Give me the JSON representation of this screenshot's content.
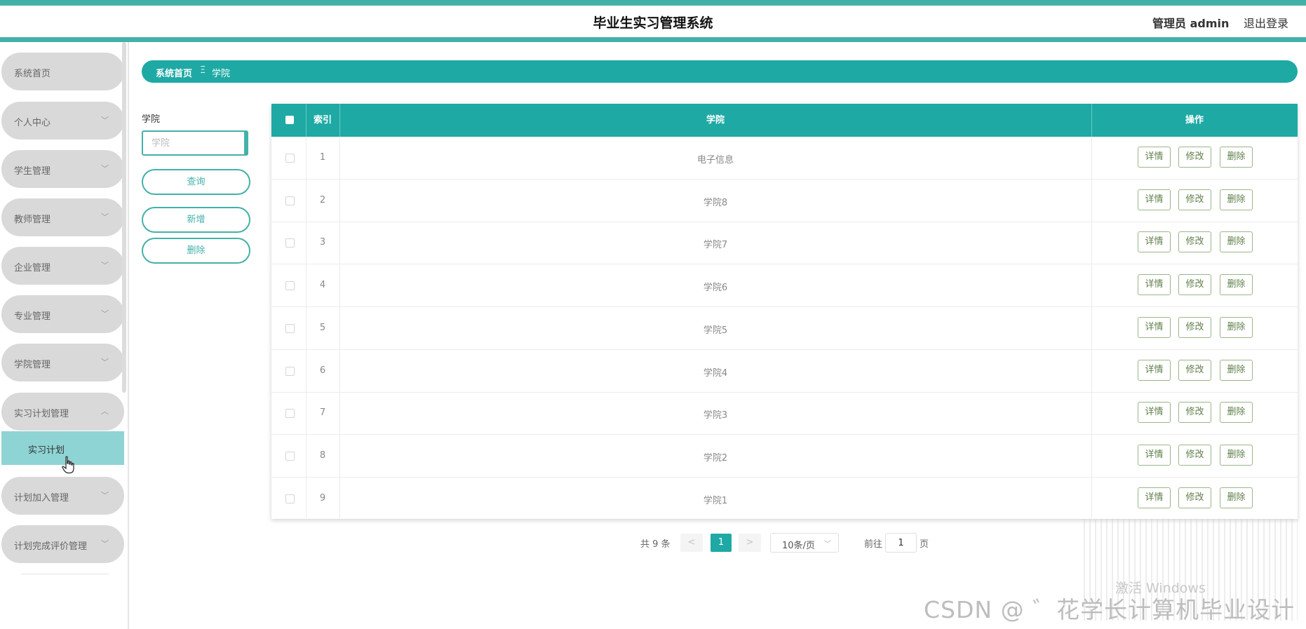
{
  "header": {
    "title": "毕业生实习管理系统",
    "admin_label": "管理员 admin",
    "logout_label": "退出登录"
  },
  "sidebar": {
    "items": [
      {
        "label": "系统首页",
        "has_chevron": false
      },
      {
        "label": "个人中心",
        "has_chevron": true
      },
      {
        "label": "学生管理",
        "has_chevron": true
      },
      {
        "label": "教师管理",
        "has_chevron": true
      },
      {
        "label": "企业管理",
        "has_chevron": true
      },
      {
        "label": "专业管理",
        "has_chevron": true
      },
      {
        "label": "学院管理",
        "has_chevron": true
      },
      {
        "label": "实习计划管理",
        "has_chevron": true,
        "expanded": true
      },
      {
        "label": "计划加入管理",
        "has_chevron": true
      },
      {
        "label": "计划完成评价管理",
        "has_chevron": true
      }
    ],
    "sub_item": "实习计划",
    "chevron_down": "﹀",
    "chevron_up": "︿"
  },
  "breadcrumb": {
    "home": "系统首页",
    "separator": "Ξ",
    "current": "学院"
  },
  "search": {
    "label": "学院",
    "placeholder": "学院",
    "value": "",
    "query_button": "查询",
    "add_button": "新增",
    "delete_button": "删除"
  },
  "table": {
    "columns": [
      "索引",
      "学院",
      "操作"
    ],
    "rows": [
      {
        "index": "1",
        "name": "电子信息"
      },
      {
        "index": "2",
        "name": "学院8"
      },
      {
        "index": "3",
        "name": "学院7"
      },
      {
        "index": "4",
        "name": "学院6"
      },
      {
        "index": "5",
        "name": "学院5"
      },
      {
        "index": "6",
        "name": "学院4"
      },
      {
        "index": "7",
        "name": "学院3"
      },
      {
        "index": "8",
        "name": "学院2"
      },
      {
        "index": "9",
        "name": "学院1"
      }
    ],
    "actions": {
      "detail": "详情",
      "edit": "修改",
      "delete": "删除"
    }
  },
  "pagination": {
    "total": "共 9 条",
    "prev": "<",
    "next": ">",
    "current_page": "1",
    "page_size": "10条/页",
    "goto_label": "前往",
    "goto_value": "1",
    "page_unit": "页"
  },
  "watermarks": {
    "windows": "激活 Windows",
    "csdn": "CSDN @ ゛花学长计算机毕业设计"
  },
  "colors": {
    "accent": "#1ea9a4",
    "header_line": "#43b1a9",
    "sidebar_item_bg": "#d9d9d9",
    "sidebar_active_bg": "#8fd4d4"
  }
}
